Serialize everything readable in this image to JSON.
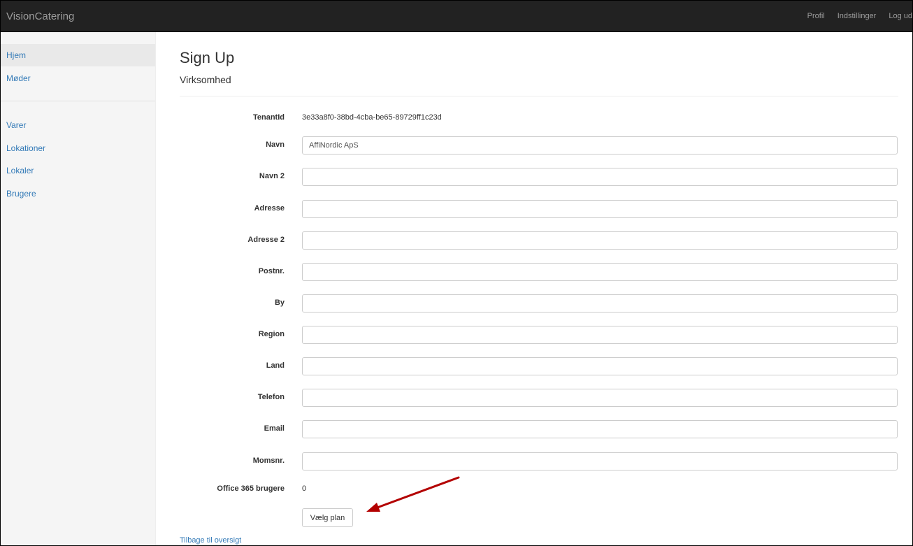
{
  "navbar": {
    "brand": "VisionCatering",
    "links": [
      "Profil",
      "Indstillinger",
      "Log ud"
    ]
  },
  "sidebar": {
    "items": [
      "Hjem",
      "Møder",
      "Varer",
      "Lokationer",
      "Lokaler",
      "Brugere"
    ],
    "active": "Hjem"
  },
  "page": {
    "title": "Sign Up",
    "subtitle": "Virksomhed"
  },
  "form": {
    "tenant_label": "TenantId",
    "tenant_value": "3e33a8f0-38bd-4cba-be65-89729ff1c23d",
    "fields": [
      {
        "label": "Navn",
        "value": "AffiNordic ApS"
      },
      {
        "label": "Navn 2",
        "value": ""
      },
      {
        "label": "Adresse",
        "value": ""
      },
      {
        "label": "Adresse 2",
        "value": ""
      },
      {
        "label": "Postnr.",
        "value": ""
      },
      {
        "label": "By",
        "value": ""
      },
      {
        "label": "Region",
        "value": ""
      },
      {
        "label": "Land",
        "value": ""
      },
      {
        "label": "Telefon",
        "value": ""
      },
      {
        "label": "Email",
        "value": ""
      },
      {
        "label": "Momsnr.",
        "value": ""
      }
    ],
    "office_label": "Office 365 brugere",
    "office_value": "0",
    "submit_label": "Vælg plan"
  },
  "back_link": "Tilbage til oversigt",
  "colors": {
    "navbar_bg": "#222222",
    "link": "#337ab7",
    "annotation_arrow": "#b30000"
  }
}
